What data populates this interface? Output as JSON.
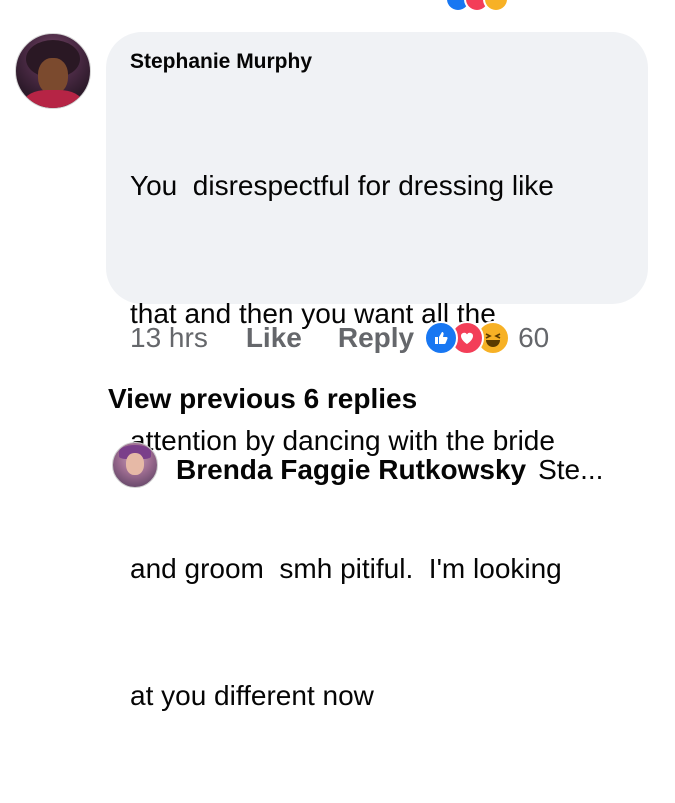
{
  "comment": {
    "author": "Stephanie Murphy",
    "lines": [
      "You  disrespectful for dressing like",
      "that and then you want all the",
      "attention by dancing with the bride",
      "and groom  smh pitiful.  I'm looking",
      "at you different now"
    ],
    "time": "13 hrs",
    "like_label": "Like",
    "reply_label": "Reply",
    "reaction_count": "60",
    "reactions": [
      "like-icon",
      "love-icon",
      "haha-icon"
    ],
    "colors": {
      "like": "#1877f2",
      "love": "#f33e58",
      "haha": "#f7b125"
    }
  },
  "view_previous": "View previous 6 replies",
  "reply_preview": {
    "author": "Brenda Faggie Rutkowsky",
    "snippet": "Ste..."
  }
}
